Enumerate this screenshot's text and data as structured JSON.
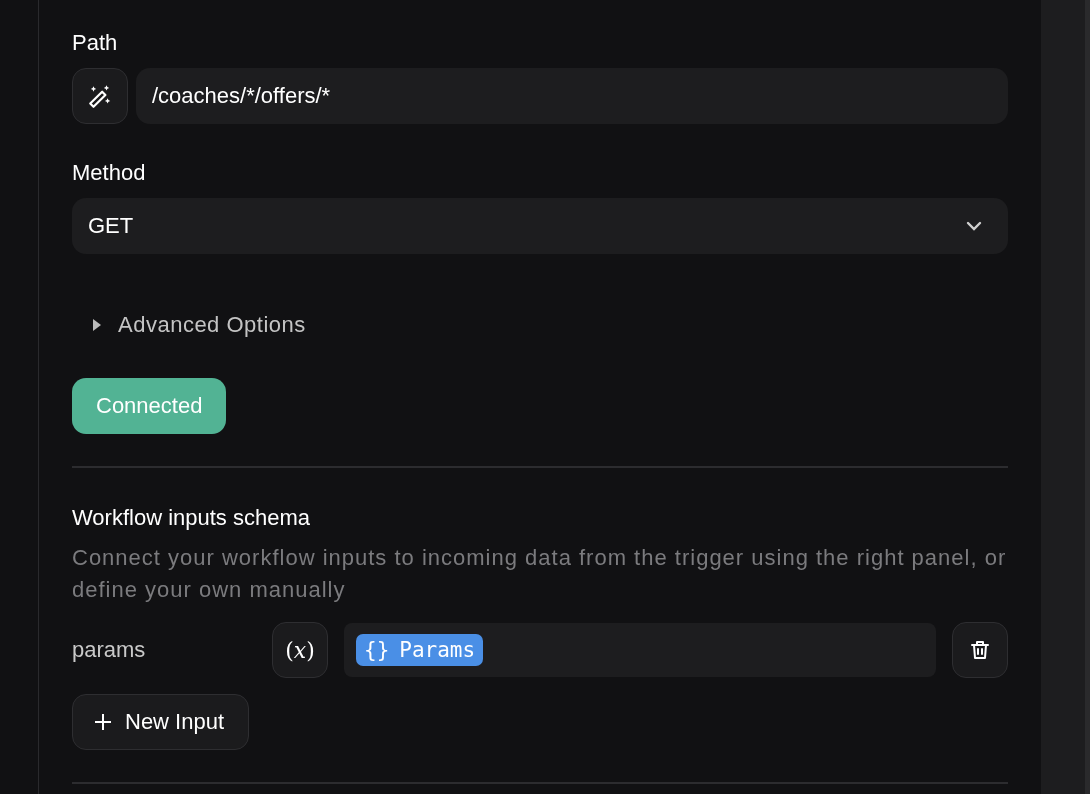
{
  "path": {
    "label": "Path",
    "value": "/coaches/*/offers/*"
  },
  "method": {
    "label": "Method",
    "value": "GET"
  },
  "advanced_options": {
    "label": "Advanced Options",
    "expanded": false
  },
  "connect_button": {
    "label": "Connected"
  },
  "schema": {
    "title": "Workflow inputs schema",
    "description": "Connect your workflow inputs to incoming data from the trigger using the right panel, or define your own manually",
    "inputs": [
      {
        "name": "params",
        "variable_button": "(*x*)",
        "chip_symbol": "{}",
        "chip_label": "Params"
      }
    ],
    "add_button": "New Input"
  }
}
